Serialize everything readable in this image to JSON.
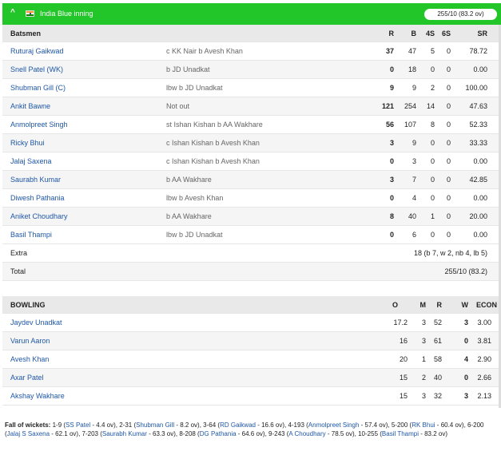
{
  "header": {
    "title": "India Blue inning",
    "score": "255/10 (83.2 ov)"
  },
  "batting": {
    "columns": [
      "Batsmen",
      "R",
      "B",
      "4S",
      "6S",
      "SR"
    ],
    "rows": [
      {
        "name": "Ruturaj Gaikwad",
        "dismissal": "c KK Nair b Avesh Khan",
        "r": "37",
        "b": "47",
        "fours": "5",
        "sixes": "0",
        "sr": "78.72"
      },
      {
        "name": "Snell Patel (WK)",
        "dismissal": "b JD Unadkat",
        "r": "0",
        "b": "18",
        "fours": "0",
        "sixes": "0",
        "sr": "0.00"
      },
      {
        "name": "Shubman Gill (C)",
        "dismissal": "lbw b JD Unadkat",
        "r": "9",
        "b": "9",
        "fours": "2",
        "sixes": "0",
        "sr": "100.00"
      },
      {
        "name": "Ankit Bawne",
        "dismissal": "Not out",
        "r": "121",
        "b": "254",
        "fours": "14",
        "sixes": "0",
        "sr": "47.63"
      },
      {
        "name": "Anmolpreet Singh",
        "dismissal": "st Ishan Kishan b AA Wakhare",
        "r": "56",
        "b": "107",
        "fours": "8",
        "sixes": "0",
        "sr": "52.33"
      },
      {
        "name": "Ricky Bhui",
        "dismissal": "c Ishan Kishan b Avesh Khan",
        "r": "3",
        "b": "9",
        "fours": "0",
        "sixes": "0",
        "sr": "33.33"
      },
      {
        "name": "Jalaj Saxena",
        "dismissal": "c Ishan Kishan b Avesh Khan",
        "r": "0",
        "b": "3",
        "fours": "0",
        "sixes": "0",
        "sr": "0.00"
      },
      {
        "name": "Saurabh Kumar",
        "dismissal": "b AA Wakhare",
        "r": "3",
        "b": "7",
        "fours": "0",
        "sixes": "0",
        "sr": "42.85"
      },
      {
        "name": "Diwesh Pathania",
        "dismissal": "lbw b Avesh Khan",
        "r": "0",
        "b": "4",
        "fours": "0",
        "sixes": "0",
        "sr": "0.00"
      },
      {
        "name": "Aniket Choudhary",
        "dismissal": "b AA Wakhare",
        "r": "8",
        "b": "40",
        "fours": "1",
        "sixes": "0",
        "sr": "20.00"
      },
      {
        "name": "Basil Thampi",
        "dismissal": "lbw b JD Unadkat",
        "r": "0",
        "b": "6",
        "fours": "0",
        "sixes": "0",
        "sr": "0.00"
      }
    ],
    "extra_label": "Extra",
    "extra_value": "18 (b 7, w 2, nb 4, lb 5)",
    "total_label": "Total",
    "total_value": "255/10 (83.2)"
  },
  "bowling": {
    "columns": [
      "BOWLING",
      "O",
      "M",
      "R",
      "W",
      "ECON"
    ],
    "rows": [
      {
        "name": "Jaydev Unadkat",
        "o": "17.2",
        "m": "3",
        "r": "52",
        "w": "3",
        "econ": "3.00"
      },
      {
        "name": "Varun Aaron",
        "o": "16",
        "m": "3",
        "r": "61",
        "w": "0",
        "econ": "3.81"
      },
      {
        "name": "Avesh Khan",
        "o": "20",
        "m": "1",
        "r": "58",
        "w": "4",
        "econ": "2.90"
      },
      {
        "name": "Axar Patel",
        "o": "15",
        "m": "2",
        "r": "40",
        "w": "0",
        "econ": "2.66"
      },
      {
        "name": "Akshay Wakhare",
        "o": "15",
        "m": "3",
        "r": "32",
        "w": "3",
        "econ": "2.13"
      }
    ]
  },
  "fall_of_wickets": {
    "label": "Fall of wickets:",
    "items": [
      {
        "pre": "1-9 (",
        "player": "SS Patel",
        "post": " - 4.4 ov), "
      },
      {
        "pre": "2-31 (",
        "player": "Shubman Gill",
        "post": " - 8.2 ov), "
      },
      {
        "pre": "3-64 (",
        "player": "RD Gaikwad",
        "post": " - 16.6 ov), "
      },
      {
        "pre": "4-193 (",
        "player": "Anmolpreet Singh",
        "post": " - 57.4 ov), "
      },
      {
        "pre": "5-200 (",
        "player": "RK Bhui",
        "post": " - 60.4 ov), "
      },
      {
        "pre": "6-200 (",
        "player": "Jalaj S Saxena",
        "post": " - 62.1 ov), "
      },
      {
        "pre": "7-203 (",
        "player": "Saurabh Kumar",
        "post": " - 63.3 ov), "
      },
      {
        "pre": "8-208 (",
        "player": "DG Pathania",
        "post": " - 64.6 ov), "
      },
      {
        "pre": "9-243 (",
        "player": "A Choudhary",
        "post": " - 78.5 ov), "
      },
      {
        "pre": "10-255 (",
        "player": "Basil Thampi",
        "post": " - 83.2 ov)"
      }
    ]
  },
  "colors": {
    "header_green": "#22c628",
    "link_blue": "#1f57a8"
  }
}
